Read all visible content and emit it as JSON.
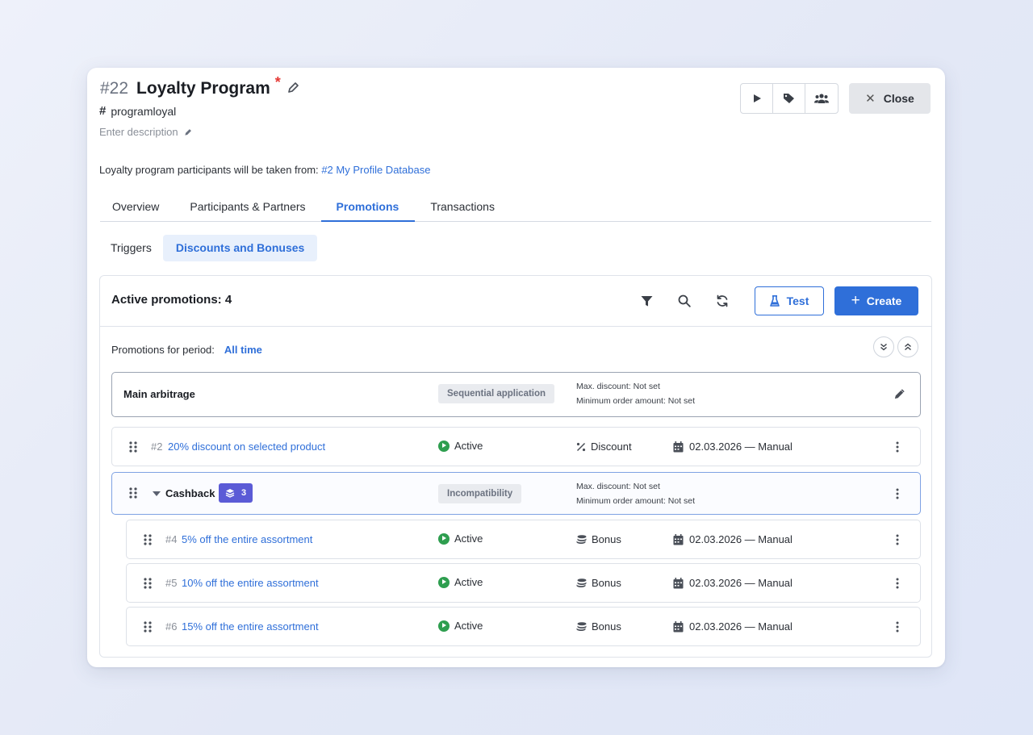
{
  "header": {
    "id": "#22",
    "title": "Loyalty Program",
    "required_mark": "*",
    "code": "programloyal",
    "description_placeholder": "Enter description",
    "close_label": "Close"
  },
  "source": {
    "text": "Loyalty program participants will be taken from:",
    "link_id": "#2",
    "link_name": "My Profile Database"
  },
  "tabs": [
    {
      "label": "Overview"
    },
    {
      "label": "Participants & Partners"
    },
    {
      "label": "Promotions",
      "active": true
    },
    {
      "label": "Transactions"
    }
  ],
  "subtabs": [
    {
      "label": "Triggers"
    },
    {
      "label": "Discounts and Bonuses",
      "active": true
    }
  ],
  "panel": {
    "title": "Active promotions: 4",
    "test_label": "Test",
    "create_label": "Create",
    "period_label": "Promotions for period:",
    "period_value": "All time"
  },
  "groups": [
    {
      "name": "Main arbitrage",
      "mode": "Sequential application",
      "max_discount": "Max. discount: Not set",
      "min_order": "Minimum order amount: Not set"
    },
    {
      "name": "Cashback",
      "count": "3",
      "mode": "Incompatibility",
      "max_discount": "Max. discount: Not set",
      "min_order": "Minimum order amount: Not set"
    }
  ],
  "promotions": [
    {
      "id": "#2",
      "name": "20% discount on selected product",
      "status": "Active",
      "type": "Discount",
      "type_icon": "percent-icon",
      "date": "02.03.2026 — Manual"
    },
    {
      "id": "#4",
      "name": "5% off the entire assortment",
      "status": "Active",
      "type": "Bonus",
      "type_icon": "coins-icon",
      "date": "02.03.2026 — Manual"
    },
    {
      "id": "#5",
      "name": "10% off the entire assortment",
      "status": "Active",
      "type": "Bonus",
      "type_icon": "coins-icon",
      "date": "02.03.2026 — Manual"
    },
    {
      "id": "#6",
      "name": "15% off the entire assortment",
      "status": "Active",
      "type": "Bonus",
      "type_icon": "coins-icon",
      "date": "02.03.2026 — Manual"
    }
  ],
  "colors": {
    "accent": "#2f6fd9",
    "active_status": "#2e9e4f",
    "badge": "#5b5bd6",
    "required": "#e53935"
  }
}
